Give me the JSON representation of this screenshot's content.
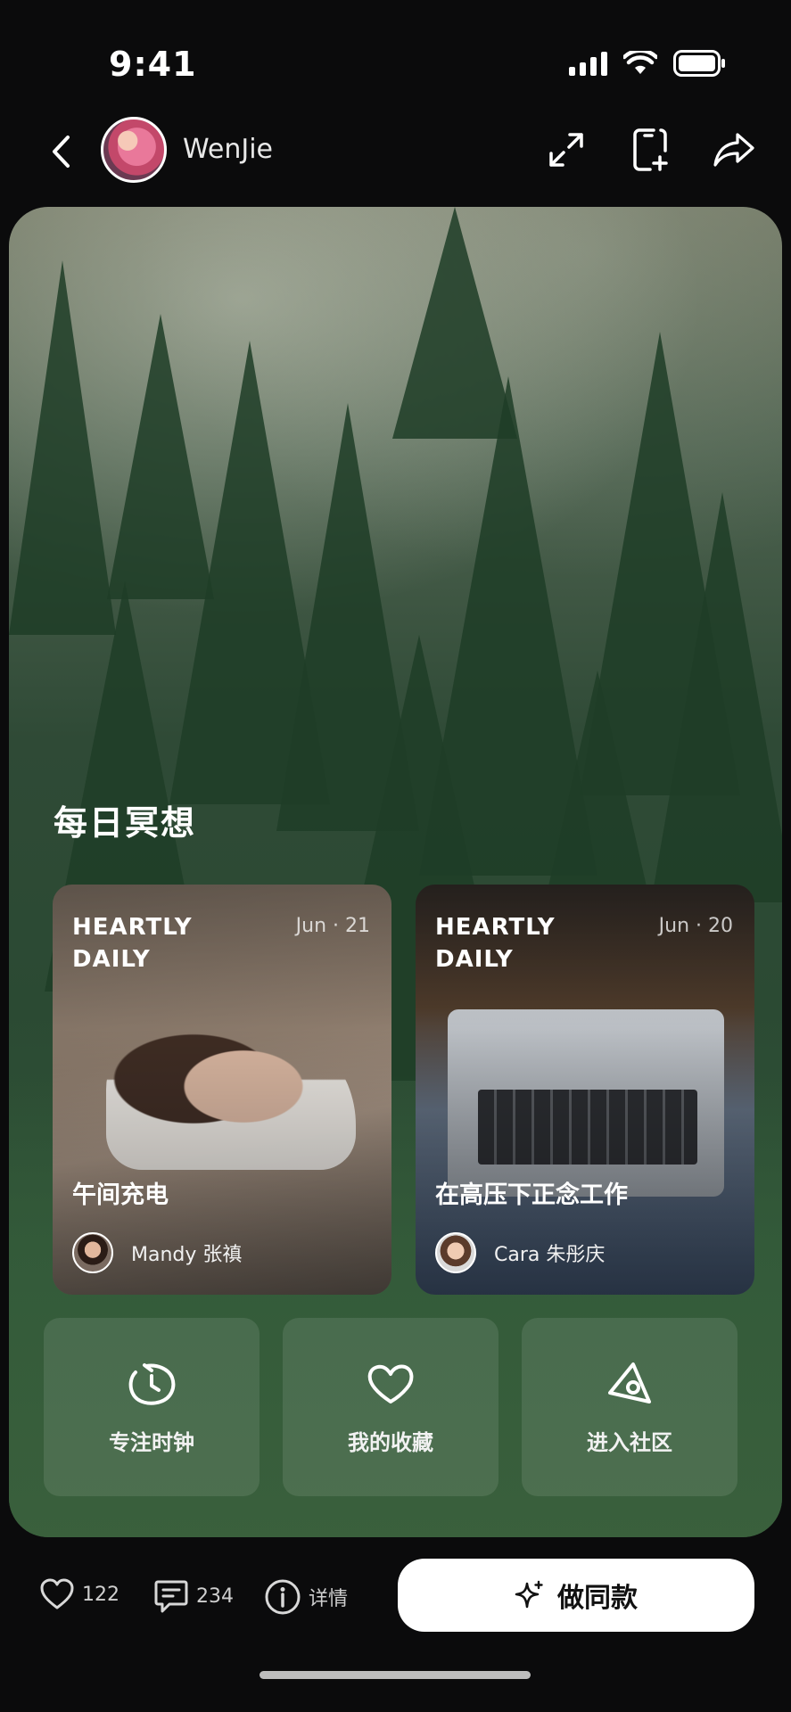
{
  "status_bar": {
    "time": "9:41"
  },
  "header": {
    "author_name": "WenJie"
  },
  "hero": {
    "section_title": "每日冥想",
    "cards": [
      {
        "brand": "HEARTLY DAILY",
        "date": "Jun · 21",
        "title": "午间充电",
        "author": "Mandy 张禛"
      },
      {
        "brand": "HEARTLY DAILY",
        "date": "Jun · 20",
        "title": "在高压下正念工作",
        "author": "Cara 朱彤庆"
      }
    ],
    "actions": [
      {
        "label": "专注时钟",
        "icon": "clock-icon"
      },
      {
        "label": "我的收藏",
        "icon": "heart-icon"
      },
      {
        "label": "进入社区",
        "icon": "community-icon"
      }
    ]
  },
  "bottom_bar": {
    "likes": "122",
    "comments": "234",
    "details_label": "详情",
    "cta_label": "做同款"
  }
}
